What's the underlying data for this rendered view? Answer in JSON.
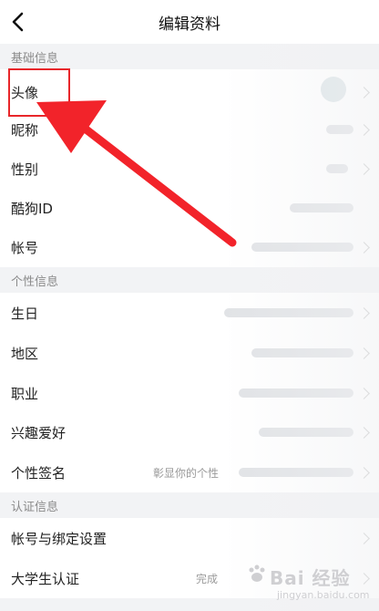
{
  "header": {
    "title": "编辑资料"
  },
  "sections": [
    {
      "title": "基础信息"
    },
    {
      "title": "个性信息"
    },
    {
      "title": "认证信息"
    }
  ],
  "rows": {
    "avatar": {
      "label": "头像"
    },
    "nickname": {
      "label": "昵称"
    },
    "gender": {
      "label": "性别"
    },
    "kugou_id": {
      "label": "酷狗ID"
    },
    "account": {
      "label": "帐号"
    },
    "birthday": {
      "label": "生日"
    },
    "region": {
      "label": "地区"
    },
    "job": {
      "label": "职业"
    },
    "hobby": {
      "label": "兴趣爱好"
    },
    "signature": {
      "label": "个性签名",
      "value": "彰显你的个性"
    },
    "binding": {
      "label": "帐号与绑定设置"
    },
    "student": {
      "label": "大学生认证",
      "value": "完成"
    }
  },
  "watermark": {
    "text": "Bai 经验",
    "url": "jingyan.baidu.com"
  },
  "colors": {
    "highlight": "#e8262a",
    "arrow": "#f2232a"
  }
}
